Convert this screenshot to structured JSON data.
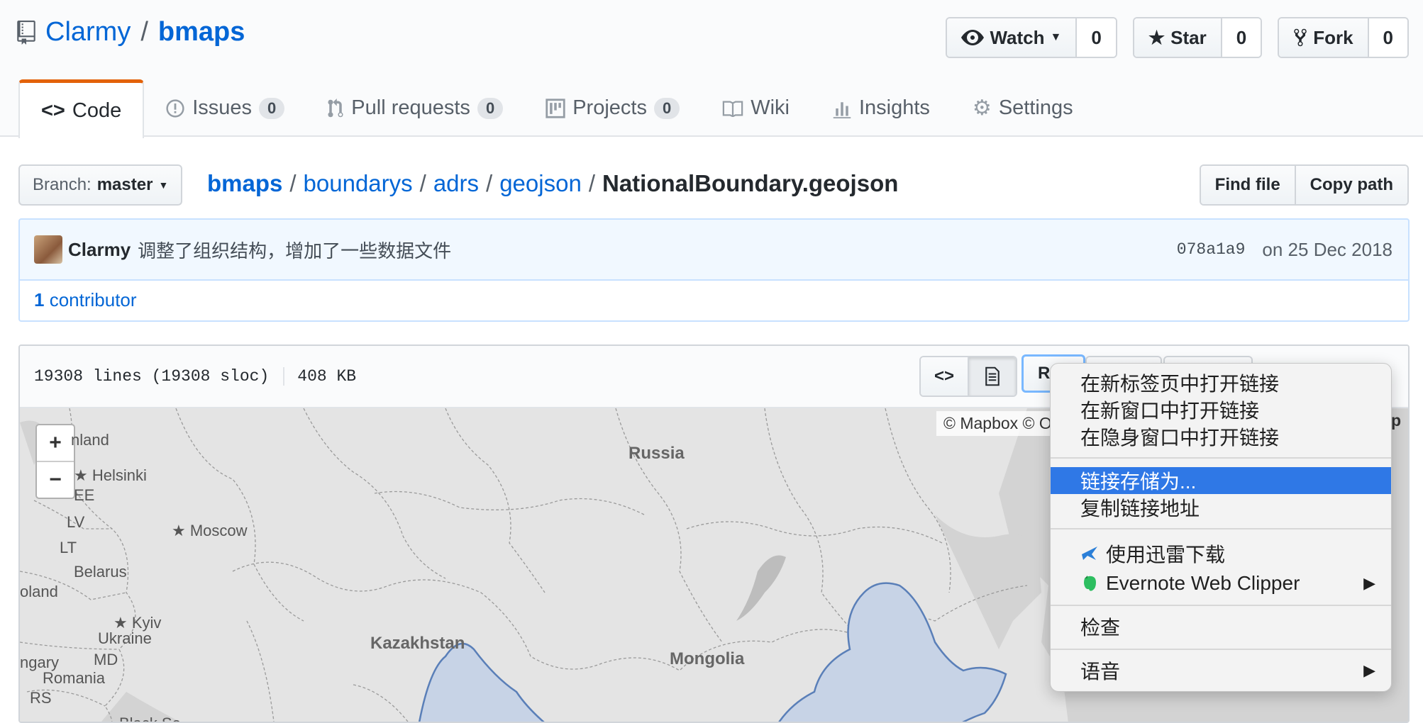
{
  "repo": {
    "owner": "Clarmy",
    "separator": "/",
    "name": "bmaps"
  },
  "actions": {
    "watch": {
      "label": "Watch",
      "count": "0"
    },
    "star": {
      "label": "Star",
      "count": "0"
    },
    "fork": {
      "label": "Fork",
      "count": "0"
    }
  },
  "tabs": [
    {
      "label": "Code"
    },
    {
      "label": "Issues",
      "count": "0"
    },
    {
      "label": "Pull requests",
      "count": "0"
    },
    {
      "label": "Projects",
      "count": "0"
    },
    {
      "label": "Wiki"
    },
    {
      "label": "Insights"
    },
    {
      "label": "Settings"
    }
  ],
  "branch": {
    "prefix": "Branch:",
    "name": "master"
  },
  "breadcrumb": {
    "parts": [
      "bmaps",
      "boundarys",
      "adrs",
      "geojson"
    ],
    "sep": "/",
    "file": "NationalBoundary.geojson"
  },
  "file_buttons": {
    "find": "Find file",
    "copy": "Copy path"
  },
  "commit": {
    "author": "Clarmy",
    "message": "调整了组织结构，增加了一些数据文件",
    "sha": "078a1a9",
    "date": "on 25 Dec 2018"
  },
  "contributors": {
    "count": "1",
    "label": "contributor"
  },
  "file_info": {
    "lines": "19308 lines (19308 sloc)",
    "size": "408 KB",
    "raw_fragment": "Ra"
  },
  "map": {
    "zoom_in": "+",
    "zoom_out": "−",
    "attribution": "© Mapbox © O",
    "attribution_right": "p",
    "labels": [
      "nland",
      "Helsinki",
      "EE",
      "LV",
      "LT",
      "Moscow",
      "Belarus",
      "oland",
      "Kyiv",
      "Ukraine",
      "ngary",
      "MD",
      "Romania",
      "RS",
      "Black Se",
      "Russia",
      "Kazakhstan",
      "Mongolia"
    ]
  },
  "context_menu": {
    "items": [
      {
        "label": "在新标签页中打开链接"
      },
      {
        "label": "在新窗口中打开链接"
      },
      {
        "label": "在隐身窗口中打开链接"
      },
      {
        "label": "链接存储为..."
      },
      {
        "label": "复制链接地址"
      },
      {
        "label": "使用迅雷下载"
      },
      {
        "label": "Evernote Web Clipper"
      },
      {
        "label": "检查"
      },
      {
        "label": "语音"
      }
    ],
    "highlight_color": "#2f78e6"
  },
  "colors": {
    "link": "#0366d6",
    "tab_accent": "#e36209",
    "commit_bg": "#f1f8ff",
    "boundary_fill": "#c7d3e6",
    "boundary_stroke": "#5a7fb8"
  }
}
